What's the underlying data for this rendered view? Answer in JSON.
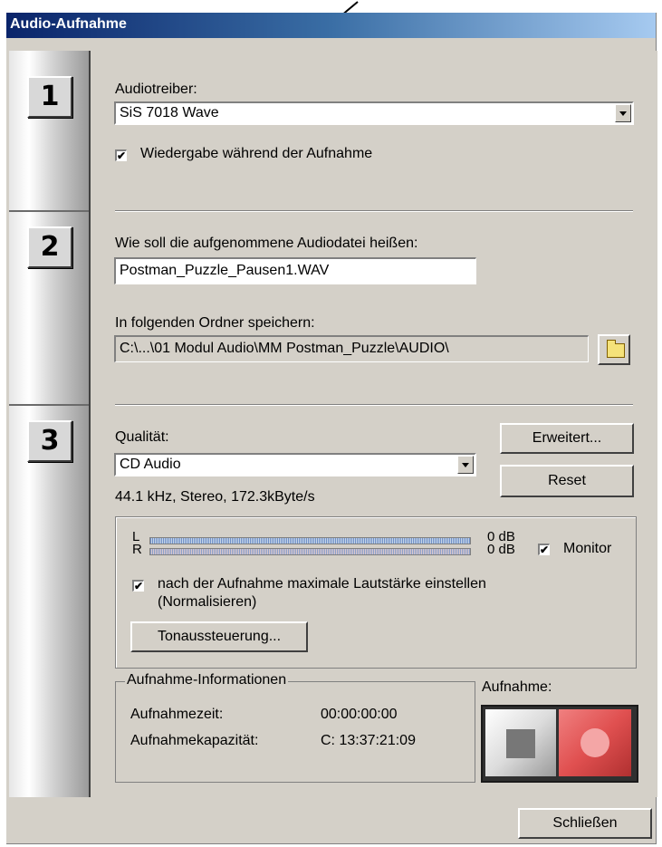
{
  "window": {
    "title": "Audio-Aufnahme"
  },
  "steps": [
    "1",
    "2",
    "3"
  ],
  "section1": {
    "driver_label": "Audiotreiber:",
    "driver_value": "SiS 7018 Wave",
    "playback_checkbox_label": "Wiedergabe während der Aufnahme",
    "playback_checked": true
  },
  "section2": {
    "filename_label": "Wie soll die aufgenommene Audiodatei heißen:",
    "filename_value": "Postman_Puzzle_Pausen1.WAV",
    "folder_label": "In folgenden Ordner speichern:",
    "folder_value": "C:\\...\\01 Modul Audio\\MM Postman_Puzzle\\AUDIO\\"
  },
  "section3": {
    "quality_label": "Qualität:",
    "quality_value": "CD Audio",
    "quality_info": "44.1 kHz, Stereo,  172.3kByte/s",
    "advanced_button": "Erweitert...",
    "reset_button": "Reset",
    "meter": {
      "left_label": "L",
      "right_label": "R",
      "left_db": "0 dB",
      "right_db": "0 dB",
      "monitor_label": "Monitor",
      "monitor_checked": true
    },
    "normalize_label_line1": "nach der Aufnahme maximale Lautstärke einstellen",
    "normalize_label_line2": "(Normalisieren)",
    "normalize_checked": true,
    "levels_button": "Tonaussteuerung...",
    "info_group_label": "Aufnahme-Informationen",
    "record_time_label": "Aufnahmezeit:",
    "record_time_value": "00:00:00:00",
    "capacity_label": "Aufnahmekapazität:",
    "capacity_value": "C: 13:37:21:09",
    "record_label": "Aufnahme:"
  },
  "footer": {
    "close_button": "Schließen"
  },
  "icons": {
    "pointer": "arrow-pointer-icon",
    "folder": "folder-icon",
    "stop": "stop-icon",
    "record": "record-icon",
    "dropdown": "chevron-down-icon",
    "checkmark": "checkmark-icon"
  },
  "colors": {
    "titlebar_start": "#0a246a",
    "titlebar_end": "#a6caf0",
    "window_bg": "#d4d0c8",
    "record_red": "#e05050"
  }
}
